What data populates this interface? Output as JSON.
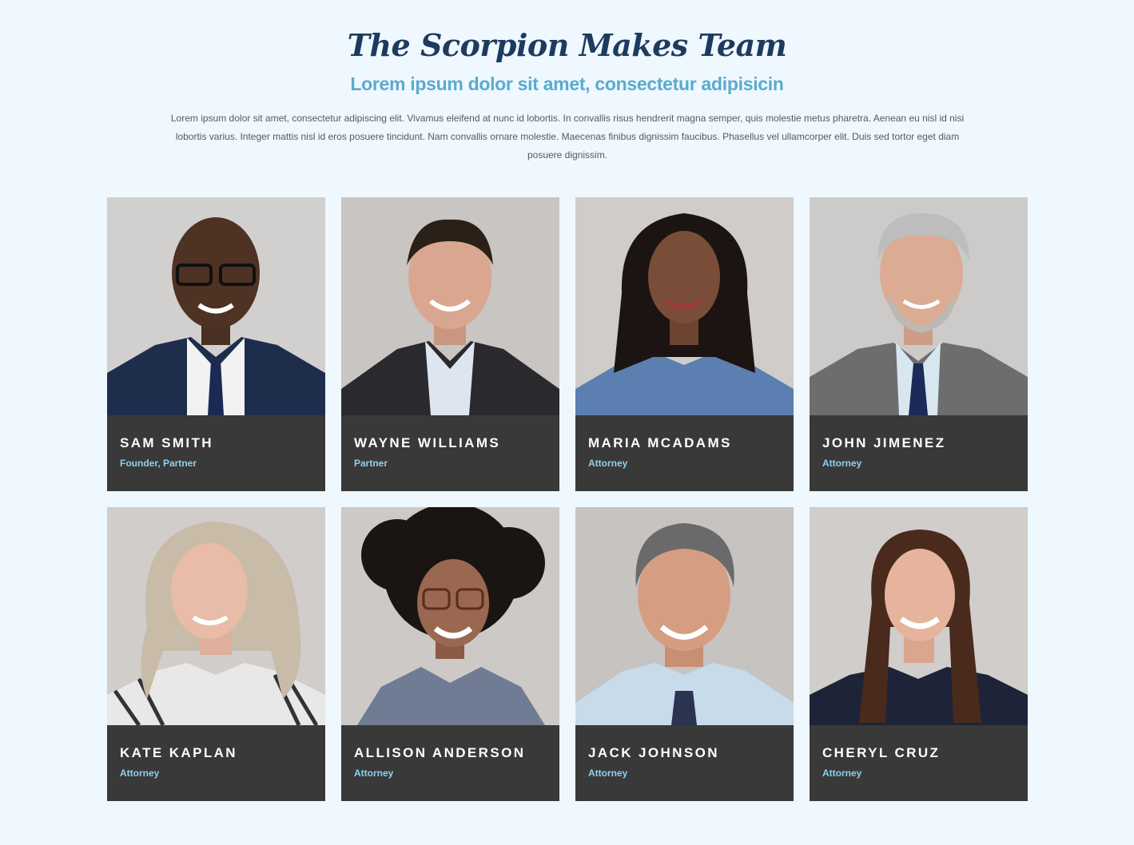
{
  "header": {
    "title": "The Scorpion Makes Team",
    "subtitle": "Lorem ipsum dolor sit amet, consectetur adipisicin",
    "description": "Lorem ipsum dolor sit amet, consectetur adipiscing elit. Vivamus eleifend at nunc id lobortis. In convallis risus hendrerit magna semper, quis molestie metus pharetra. Aenean eu nisl id nisi lobortis varius. Integer mattis nisl id eros posuere tincidunt. Nam convallis ornare molestie. Maecenas finibus dignissim faucibus. Phasellus vel ullamcorper elit. Duis sed tortor eget diam posuere dignissim."
  },
  "team": [
    {
      "name": "SAM SMITH",
      "role": "Founder, Partner"
    },
    {
      "name": "WAYNE WILLIAMS",
      "role": "Partner"
    },
    {
      "name": "MARIA MCADAMS",
      "role": "Attorney"
    },
    {
      "name": "JOHN JIMENEZ",
      "role": "Attorney"
    },
    {
      "name": "KATE KAPLAN",
      "role": "Attorney"
    },
    {
      "name": "ALLISON ANDERSON",
      "role": "Attorney"
    },
    {
      "name": "JACK JOHNSON",
      "role": "Attorney"
    },
    {
      "name": "CHERYL CRUZ",
      "role": "Attorney"
    }
  ]
}
